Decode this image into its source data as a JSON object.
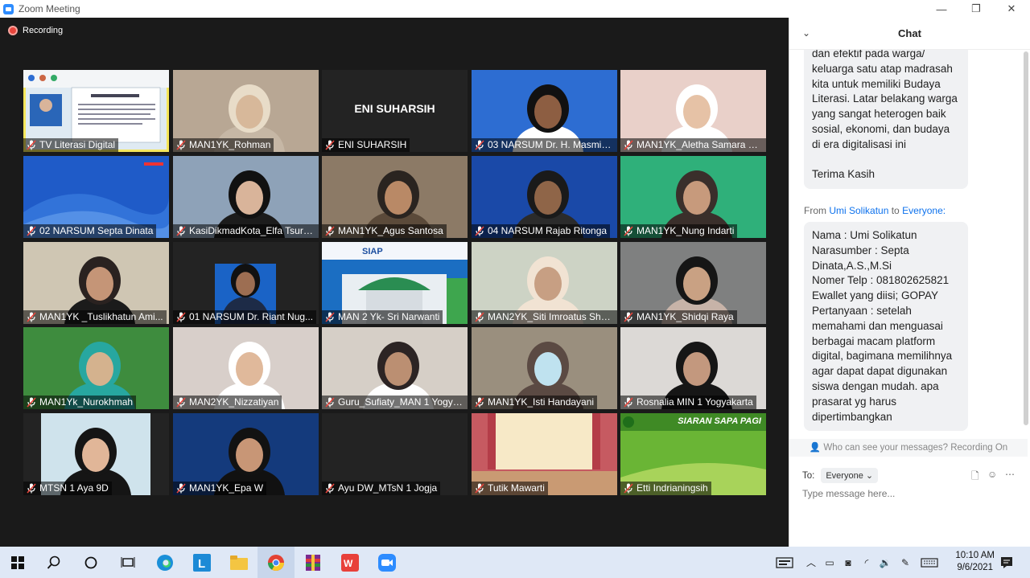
{
  "window": {
    "title": "Zoom Meeting",
    "minimize": "—",
    "maximize": "❐",
    "close": "✕"
  },
  "recording": {
    "label": "Recording"
  },
  "tiles": [
    {
      "name": "TV Literasi Digital",
      "bg": "#dfeaf2",
      "active": true,
      "kind": "screen"
    },
    {
      "name": "MAN1YK_Rohman",
      "bg": "#b8a794",
      "kind": "person",
      "skin": "#d7b89a",
      "hair": "#e8dcc8",
      "shirt": "#c6b7a5"
    },
    {
      "name": "ENI SUHARSIH",
      "bg": "#232323",
      "kind": "text",
      "big": "ENI SUHARSIH"
    },
    {
      "name": "03 NARSUM Dr. H. Masmin Af...",
      "bg": "#2d6dd2",
      "kind": "person",
      "skin": "#8d5e42",
      "hair": "#111111",
      "shirt": "#ffffff"
    },
    {
      "name": "MAN1YK_Aletha Samara G...",
      "bg": "#e9d0c9",
      "kind": "person",
      "skin": "#e6c2a6",
      "hair": "#ffffff",
      "shirt": "#ffffff"
    },
    {
      "name": "02 NARSUM Septa Dinata",
      "bg": "#1f5bc8",
      "kind": "wave"
    },
    {
      "name": "KasiDikmadKota_Elfa Tsuro...",
      "bg": "#8ea2b8",
      "kind": "person",
      "skin": "#d9b49a",
      "hair": "#111111",
      "shirt": "#1c1c1c"
    },
    {
      "name": "MAN1YK_Agus Santosa",
      "bg": "#8c7a66",
      "kind": "person",
      "skin": "#b98966",
      "hair": "#2a2420",
      "shirt": "#5b4a3a"
    },
    {
      "name": "04 NARSUM Rajab Ritonga",
      "bg": "#1a49a8",
      "kind": "person",
      "skin": "#8f6548",
      "hair": "#1a1a1a",
      "shirt": "#2b2b2b"
    },
    {
      "name": "MAN1YK_Nung Indarti",
      "bg": "#2fb07a",
      "kind": "person",
      "skin": "#c79a7c",
      "hair": "#3a2f2b",
      "shirt": "#3a2f2b"
    },
    {
      "name": "MAN1YK _Tuslikhatun Ami...",
      "bg": "#cfc6b3",
      "kind": "person",
      "skin": "#c59577",
      "hair": "#2a2220",
      "shirt": "#1b1b1b"
    },
    {
      "name": "01 NARSUM Dr. Riant Nug...",
      "bg": "#232323",
      "kind": "portrait",
      "skin": "#9d6e52",
      "hair": "#111111",
      "shirt": "#1d2b47"
    },
    {
      "name": "MAN 2 Yk- Sri Narwanti",
      "bg": "#1b6ec2",
      "kind": "building"
    },
    {
      "name": "MAN2YK_Siti Imroatus Sholich...",
      "bg": "#cdd3c5",
      "kind": "person",
      "skin": "#c79f83",
      "hair": "#f1e3d3",
      "shirt": "#f1e3d3"
    },
    {
      "name": "MAN1YK_Shidqi Raya",
      "bg": "#7f8080",
      "kind": "person",
      "skin": "#c9a183",
      "hair": "#161616",
      "shirt": "#c7b3a8"
    },
    {
      "name": "MAN1Yk_Nurokhmah",
      "bg": "#3e8c3e",
      "kind": "person",
      "skin": "#d4b28e",
      "hair": "#27a7a0",
      "shirt": "#27a7a0"
    },
    {
      "name": "MAN2YK_Nizzatiyan",
      "bg": "#d8cfca",
      "kind": "person",
      "skin": "#e0b99b",
      "hair": "#ffffff",
      "shirt": "#ffffff"
    },
    {
      "name": "Guru_Sufiaty_MAN 1 Yogya...",
      "bg": "#d6cfc7",
      "kind": "person",
      "skin": "#bb8f72",
      "hair": "#2c2424",
      "shirt": "#fefefe"
    },
    {
      "name": "MAN1YK_Isti Handayani",
      "bg": "#9a8f7e",
      "kind": "person",
      "skin": "#bfe2ef",
      "hair": "#5b4a43",
      "shirt": "#5b4a43"
    },
    {
      "name": "Rosnalia MIN 1 Yogyakarta",
      "bg": "#dcd9d6",
      "kind": "person",
      "skin": "#c3987e",
      "hair": "#161616",
      "shirt": "#161616"
    },
    {
      "name": "MTSN 1 Aya 9D",
      "bg": "#232323",
      "kind": "portraitwide",
      "skin": "#e1b698",
      "hair": "#151515",
      "shirt": "#151515"
    },
    {
      "name": "MAN1YK_Epa W",
      "bg": "#143a7c",
      "kind": "person",
      "skin": "#c89676",
      "hair": "#121212",
      "shirt": "#111111"
    },
    {
      "name": "Ayu DW_MTsN 1 Jogja",
      "bg": "#232323",
      "kind": "blank"
    },
    {
      "name": "Tutik Mawarti",
      "bg": "#c65a61",
      "kind": "curtain"
    },
    {
      "name": "Etti Indrianingsih",
      "bg": "#6ab535",
      "kind": "banner",
      "banner": "SIARAN SAPA PAGI"
    }
  ],
  "chat": {
    "header": "Chat",
    "prev_message": "dan efektif pada warga/ keluarga satu atap madrasah kita untuk memiliki Budaya Literasi. Latar belakang warga yang sangat heterogen baik sosial, ekonomi, dan budaya di era digitalisasi ini\n\nTerima Kasih",
    "from_label": "From",
    "from_name": "Umi Solikatun",
    "to_label": "to",
    "to_name": "Everyone:",
    "message": "Nama : Umi Solikatun\nNarasumber : Septa Dinata,A.S.,M.Si\nNomer Telp : 081802625821\nEwallet yang diisi; GOPAY\nPertanyaan : setelah memahami dan menguasai berbagai macam platform digital, bagimana memilihnya agar dapat dapat digunakan siswa dengan mudah. apa prasarat yg harus dipertimbangkan",
    "visibility": "Who can see your messages? Recording On",
    "to_prefix": "To:",
    "recipient": "Everyone",
    "placeholder": "Type message here..."
  },
  "taskbar": {
    "time": "10:10 AM",
    "date": "9/6/2021"
  }
}
